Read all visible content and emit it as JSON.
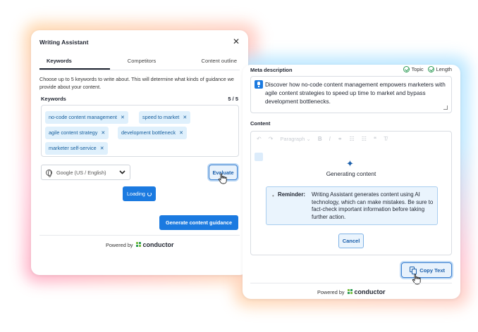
{
  "writing_assistant": {
    "title": "Writing Assistant",
    "close_glyph": "✕",
    "tabs": [
      {
        "label": "Keywords",
        "active": true
      },
      {
        "label": "Competitors",
        "active": false
      },
      {
        "label": "Content outline",
        "active": false
      }
    ],
    "intro": "Choose up to 5 keywords to write about. This will determine what kinds of guidance we provide about your content.",
    "keywords_label": "Keywords",
    "keywords_count": "5 / 5",
    "keywords": [
      "no-code content management",
      "speed to market",
      "agile content strategy",
      "development bottleneck",
      "marketer self-service"
    ],
    "chip_remove_glyph": "✕",
    "search_engine": "Google (US / English)",
    "evaluate_label": "Evaluate",
    "loading_label": "Loading",
    "generate_label": "Generate content guidance",
    "powered_by": "Powered by",
    "brand": "conductor"
  },
  "content_panel": {
    "meta_label": "Meta description",
    "badges": [
      "Topic",
      "Length"
    ],
    "meta_text": "Discover how no-code content management empowers marketers with agile content strategies to speed up time to market and bypass development bottlenecks.",
    "content_label": "Content",
    "toolbar": {
      "undo": "↶",
      "redo": "↷",
      "paragraph": "Paragraph",
      "dropdown": "⌄",
      "bold": "B",
      "italic": "I",
      "link": "⚭",
      "ordered_list": "☷",
      "bullet_list": "☷",
      "quote": "❝",
      "clear": "T̸"
    },
    "sparkle_glyph": "✦",
    "generating_text": "Generating content",
    "reminder_bullet": "•",
    "reminder_label": "Reminder:",
    "reminder_text": "Writing Assistant generates content using AI technology, which can make mistakes. Be sure to fact-check important information before taking further action.",
    "cancel_label": "Cancel",
    "copy_label": "Copy Text",
    "powered_by": "Powered by",
    "brand": "conductor"
  },
  "colors": {
    "accent": "#1b7ae0",
    "chip_bg": "#dff0fc",
    "chip_text": "#145d9c",
    "check_green": "#2e9c57"
  }
}
